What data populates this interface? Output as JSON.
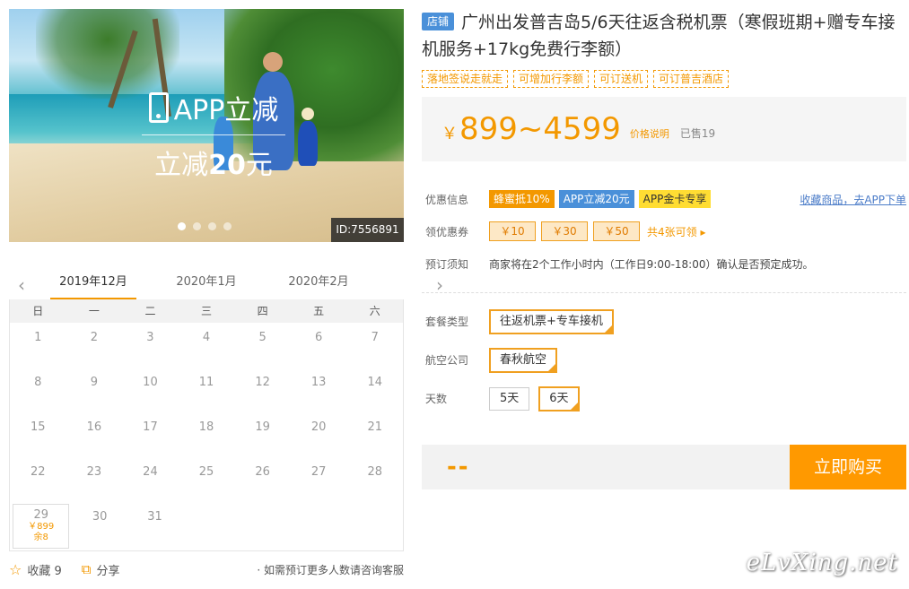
{
  "banner": {
    "app_text": "APP立减",
    "reduce_prefix": "立减",
    "reduce_amount": "20",
    "reduce_suffix": "元",
    "id_label": "ID:7556891",
    "dot_count": 4,
    "active_dot": 0
  },
  "calendar": {
    "months": [
      "2019年12月",
      "2020年1月",
      "2020年2月"
    ],
    "active_month": 0,
    "weekdays": [
      "日",
      "一",
      "二",
      "三",
      "四",
      "五",
      "六"
    ],
    "weeks": [
      [
        "1",
        "2",
        "3",
        "4",
        "5",
        "6",
        "7"
      ],
      [
        "8",
        "9",
        "10",
        "11",
        "12",
        "13",
        "14"
      ],
      [
        "15",
        "16",
        "17",
        "18",
        "19",
        "20",
        "21"
      ],
      [
        "22",
        "23",
        "24",
        "25",
        "26",
        "27",
        "28"
      ],
      [
        "29",
        "30",
        "31",
        "",
        "",
        "",
        ""
      ]
    ],
    "selected_day": {
      "day": "29",
      "price": "￥899",
      "remaining": "余8"
    }
  },
  "bottom": {
    "favorite_label": "收藏 9",
    "share_label": "分享",
    "note": "· 如需预订更多人数请咨询客服"
  },
  "product": {
    "shop_tag": "店铺",
    "title": "广州出发普吉岛5/6天往返含税机票（寒假班期+赠专车接机服务+17kg免费行李额）",
    "feature_tags": [
      "落地签说走就走",
      "可增加行李额",
      "可订送机",
      "可订普吉酒店"
    ],
    "currency": "￥",
    "price_range": "899~4599",
    "price_explain": "价格说明",
    "sold": "已售19"
  },
  "info": {
    "promo_label": "优惠信息",
    "promo_badges": [
      {
        "text": "蜂蜜抵10%",
        "style": "orange"
      },
      {
        "text": "APP立减20元",
        "style": "blue"
      },
      {
        "text": "APP金卡专享",
        "style": "yellow"
      }
    ],
    "collect_link": "收藏商品，去APP下单",
    "coupon_label": "领优惠券",
    "coupons": [
      "￥10",
      "￥30",
      "￥50"
    ],
    "coupon_count": "共4张可领 ▸",
    "notice_label": "预订须知",
    "notice_text": "商家将在2个工作小时内（工作日9:00-18:00）确认是否预定成功。"
  },
  "options": {
    "package_label": "套餐类型",
    "package_values": [
      "往返机票+专车接机"
    ],
    "airline_label": "航空公司",
    "airline_values": [
      "春秋航空"
    ],
    "days_label": "天数",
    "days_values": [
      "5天",
      "6天"
    ],
    "days_selected": "6天"
  },
  "buy": {
    "quantity": "--",
    "button": "立即购买"
  },
  "watermark": "eLvXing.net",
  "colors": {
    "accent": "#f39800",
    "blue": "#4a90d9",
    "yellow": "#ffdd33"
  }
}
